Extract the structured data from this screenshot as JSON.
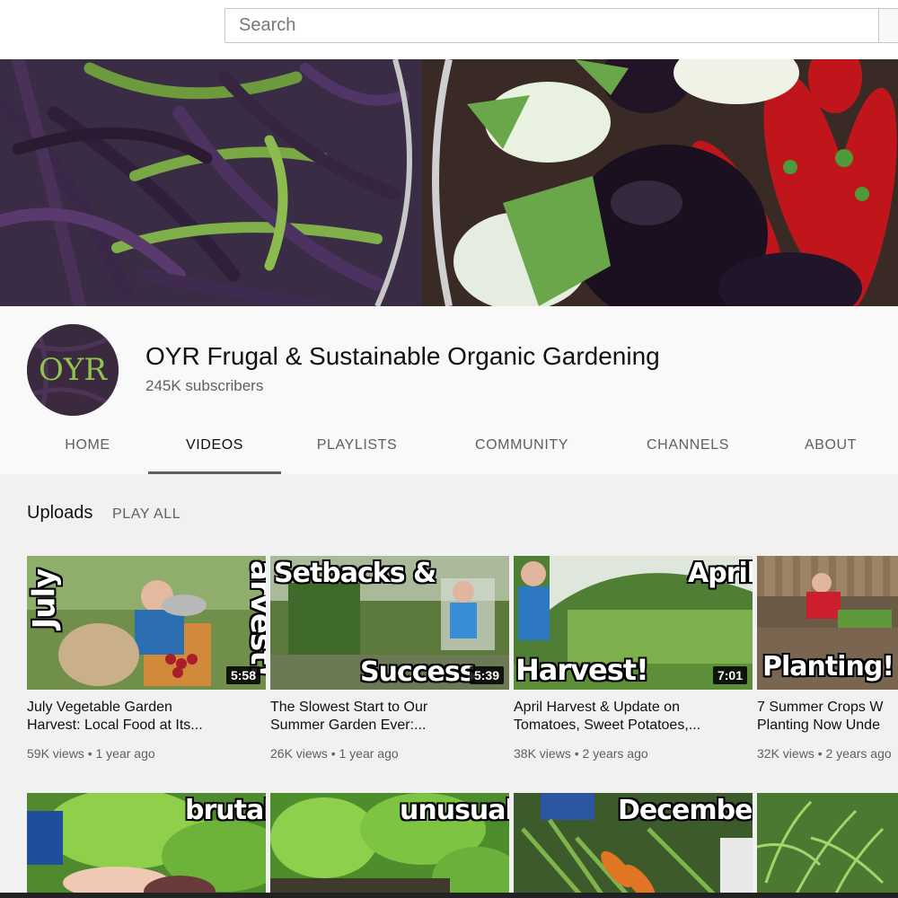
{
  "search": {
    "placeholder": "Search"
  },
  "channel": {
    "name": "OYR Frugal & Sustainable Organic Gardening",
    "subscribers": "245K subscribers",
    "avatar_text": "OYR"
  },
  "tabs": [
    {
      "label": "HOME",
      "active": false
    },
    {
      "label": "VIDEOS",
      "active": true
    },
    {
      "label": "PLAYLISTS",
      "active": false
    },
    {
      "label": "COMMUNITY",
      "active": false
    },
    {
      "label": "CHANNELS",
      "active": false
    },
    {
      "label": "ABOUT",
      "active": false
    }
  ],
  "uploads": {
    "title": "Uploads",
    "play_all": "PLAY ALL",
    "videos": [
      {
        "title_line1": "July Vegetable Garden",
        "title_line2": "Harvest: Local Food at Its...",
        "views": "59K views",
        "age": "1 year ago",
        "duration": "5:58",
        "overlay1": "July",
        "overlay2": "arvest!"
      },
      {
        "title_line1": "The Slowest Start to Our",
        "title_line2": "Summer Garden Ever:...",
        "views": "26K views",
        "age": "1 year ago",
        "duration": "5:39",
        "overlay1": "Setbacks &",
        "overlay2": "Success"
      },
      {
        "title_line1": "April Harvest & Update on",
        "title_line2": "Tomatoes, Sweet Potatoes,...",
        "views": "38K views",
        "age": "2 years ago",
        "duration": "7:01",
        "overlay1": "April",
        "overlay2": "Harvest!"
      },
      {
        "title_line1": "7 Summer Crops W",
        "title_line2": "Planting Now Unde",
        "views": "32K views",
        "age": "2 years ago",
        "duration": "",
        "overlay1": "Planting!",
        "overlay2": ""
      }
    ],
    "row2_overlays": [
      "brutal",
      "unusual",
      "December",
      ""
    ]
  },
  "meta_separator": "•"
}
